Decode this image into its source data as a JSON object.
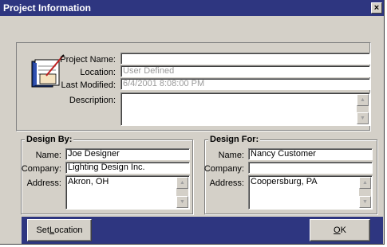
{
  "window": {
    "title": "Project Information",
    "close_glyph": "×"
  },
  "project": {
    "name_label": "Project Name:",
    "name_value": "",
    "location_label": "Location:",
    "location_value": "User Defined",
    "modified_label": "Last Modified:",
    "modified_value": "6/4/2001 8:08:00 PM",
    "description_label": "Description:",
    "description_value": ""
  },
  "design_by": {
    "title": "Design By:",
    "name_label": "Name:",
    "name_value": "Joe Designer",
    "company_label": "Company:",
    "company_value": "Lighting Design Inc.",
    "address_label": "Address:",
    "address_value": "Akron, OH"
  },
  "design_for": {
    "title": "Design For:",
    "name_label": "Name:",
    "name_value": "Nancy Customer",
    "company_label": "Company:",
    "company_value": "",
    "address_label": "Address:",
    "address_value": "Coopersburg, PA"
  },
  "buttons": {
    "set_location_pre": "Set ",
    "set_location_key": "L",
    "set_location_post": "ocation",
    "ok_key": "O",
    "ok_post": "K"
  },
  "colors": {
    "titlebar": "#2e3680",
    "face": "#d4d0c8",
    "footer": "#2e3680"
  }
}
